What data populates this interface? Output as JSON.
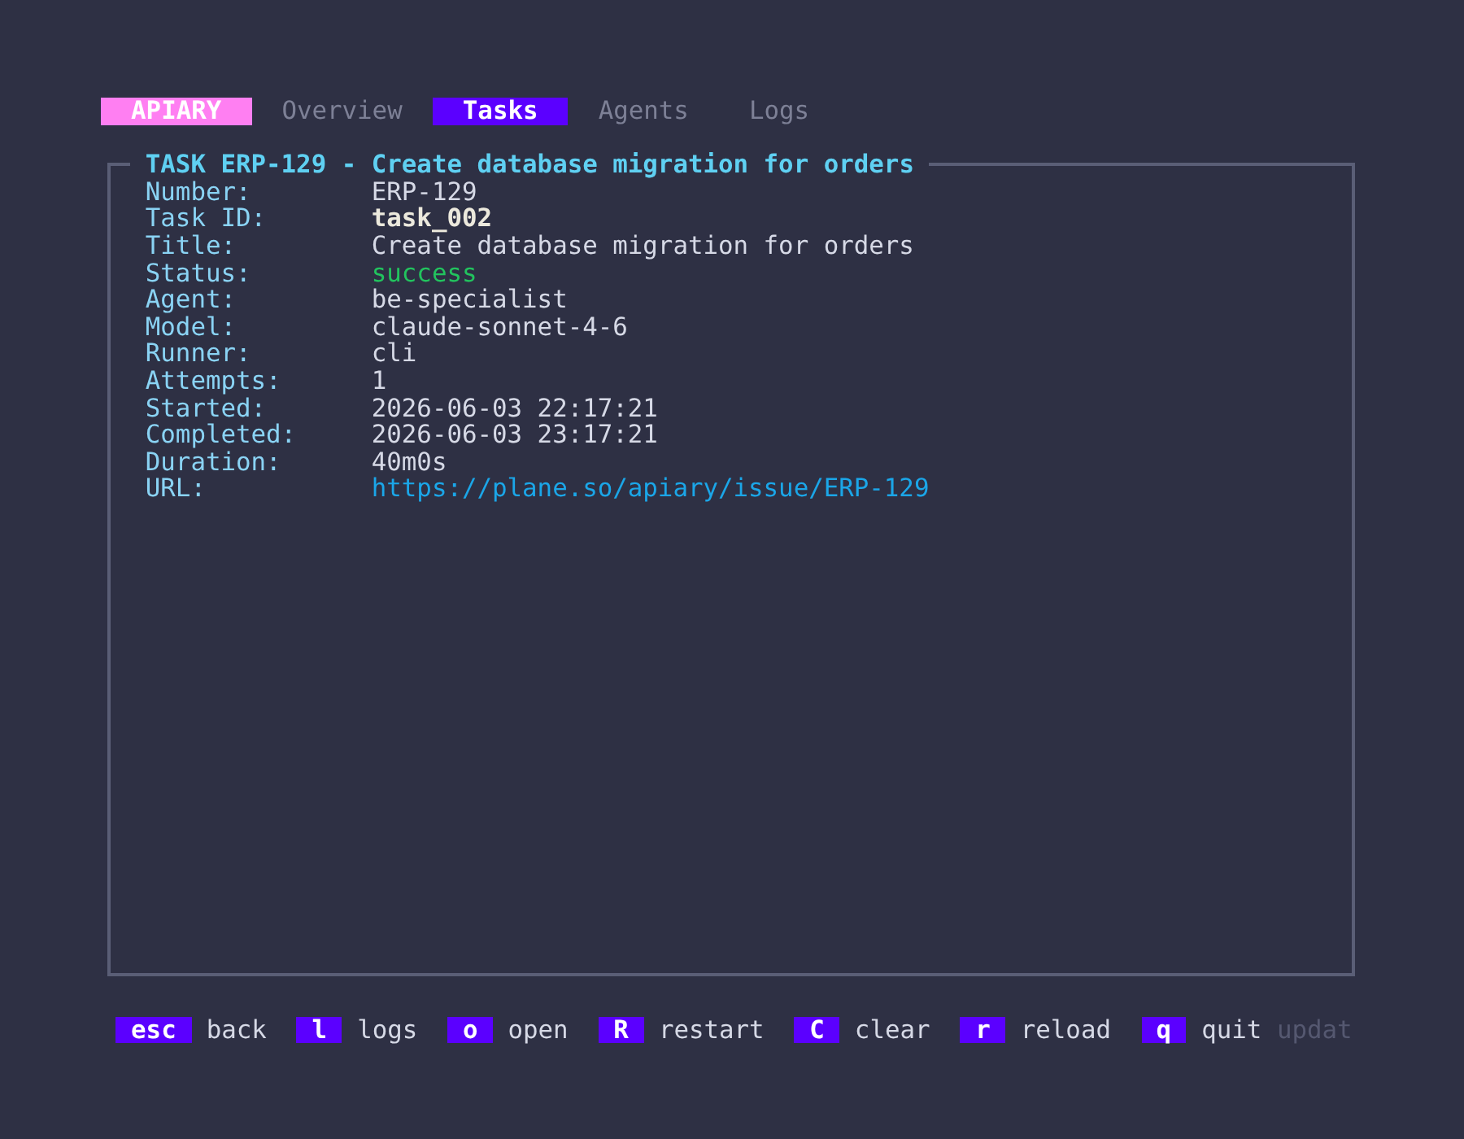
{
  "app": {
    "name": "APIARY"
  },
  "tabs": [
    {
      "label": "Overview",
      "selected": false
    },
    {
      "label": "Tasks",
      "selected": true
    },
    {
      "label": "Agents",
      "selected": false
    },
    {
      "label": "Logs",
      "selected": false
    }
  ],
  "panel": {
    "title": "TASK ERP-129 - Create database migration for orders",
    "fields": [
      {
        "label": "Number:",
        "value": "ERP-129",
        "kind": "text"
      },
      {
        "label": "Task ID:",
        "value": "task_002",
        "kind": "id"
      },
      {
        "label": "Title:",
        "value": "Create database migration for orders",
        "kind": "text"
      },
      {
        "label": "Status:",
        "value": "success",
        "kind": "status"
      },
      {
        "label": "Agent:",
        "value": "be-specialist",
        "kind": "text"
      },
      {
        "label": "Model:",
        "value": "claude-sonnet-4-6",
        "kind": "text"
      },
      {
        "label": "Runner:",
        "value": "cli",
        "kind": "text"
      },
      {
        "label": "Attempts:",
        "value": "1",
        "kind": "text"
      },
      {
        "label": "Started:",
        "value": "2026-06-03 22:17:21",
        "kind": "text"
      },
      {
        "label": "Completed:",
        "value": "2026-06-03 23:17:21",
        "kind": "text"
      },
      {
        "label": "Duration:",
        "value": "40m0s",
        "kind": "text"
      },
      {
        "label": "URL:",
        "value": "https://plane.so/apiary/issue/ERP-129",
        "kind": "link"
      }
    ]
  },
  "footer": {
    "shortcuts": [
      {
        "key": "esc",
        "label": "back"
      },
      {
        "key": "l",
        "label": "logs"
      },
      {
        "key": "o",
        "label": "open"
      },
      {
        "key": "R",
        "label": "restart"
      },
      {
        "key": "C",
        "label": "clear"
      },
      {
        "key": "r",
        "label": "reload"
      },
      {
        "key": "q",
        "label": "quit"
      }
    ],
    "status": "updat"
  }
}
